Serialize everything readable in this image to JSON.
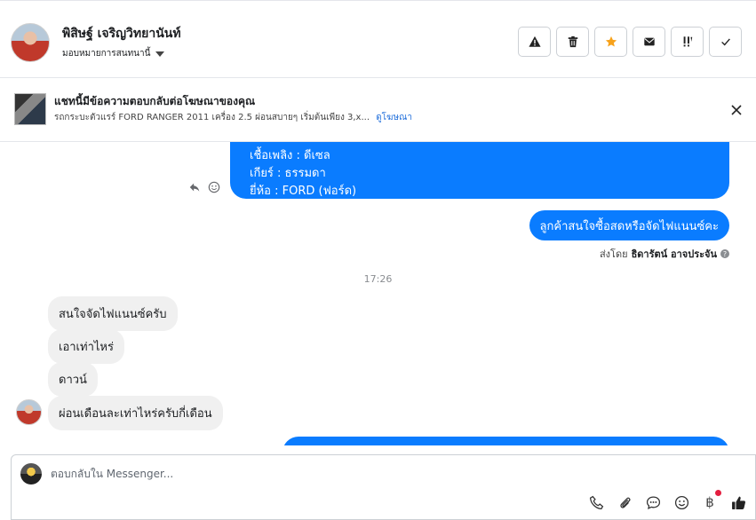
{
  "header": {
    "contact_name": "พิสิษฐ์ เจริญวิทยานันท์",
    "assign_label": "มอบหมายการสนทนานี้",
    "actions": [
      {
        "name": "spam-button",
        "icon": "warning-icon",
        "glyph": "⚠"
      },
      {
        "name": "delete-button",
        "icon": "trash-icon",
        "glyph": "🗑"
      },
      {
        "name": "star-button",
        "icon": "star-icon",
        "glyph": "★",
        "color": "#f7a21b"
      },
      {
        "name": "mark-unread-button",
        "icon": "envelope-icon",
        "glyph": "✉"
      },
      {
        "name": "follow-up-button",
        "icon": "flag-exclaim-icon",
        "glyph": "!!"
      },
      {
        "name": "mark-done-button",
        "icon": "check-icon",
        "glyph": "✓"
      }
    ]
  },
  "ad_banner": {
    "title": "แชทนี้มีข้อความตอบกลับต่อโฆษณาของคุณ",
    "subtitle": "รถกระบะตัวแรร์ FORD RANGER 2011 เครื่อง 2.5 ผ่อนสบายๆ เริ่มต้นเพียง 3,x...",
    "link": "ดูโฆษณา"
  },
  "messages": {
    "spec_lines": [
      "เชื้อเพลิง : ดีเซล",
      "เกียร์ : ธรรมดา",
      "ยี่ห้อ : FORD (ฟอร์ด)"
    ],
    "outgoing_interest": "ลูกค้าสนใจซื้อสดหรือจัดไฟแนนซ์คะ",
    "sent_by_prefix": "ส่งโดย",
    "sent_by_name": "ธิดารัตน์ อาจประจัน",
    "timestamp": "17:26",
    "incoming": [
      "สนใจจัดไฟแนนซ์ครับ",
      "เอาเท่าไหร่",
      "ดาวน์",
      "ผ่อนเดือนละเท่าไหร่ครับกี่เดือน"
    ]
  },
  "composer": {
    "placeholder": "ตอบกลับใน Messenger...",
    "tools": [
      "phone-icon",
      "paperclip-icon",
      "chat-bubble-icon",
      "emoji-icon",
      "baht-icon",
      "thumbs-up-icon"
    ]
  },
  "colors": {
    "outgoing_bubble": "#0a7cff",
    "incoming_bubble": "#f0f0f0",
    "star": "#f7a21b",
    "link": "#216fdb",
    "notification_dot": "#e41e3f"
  }
}
